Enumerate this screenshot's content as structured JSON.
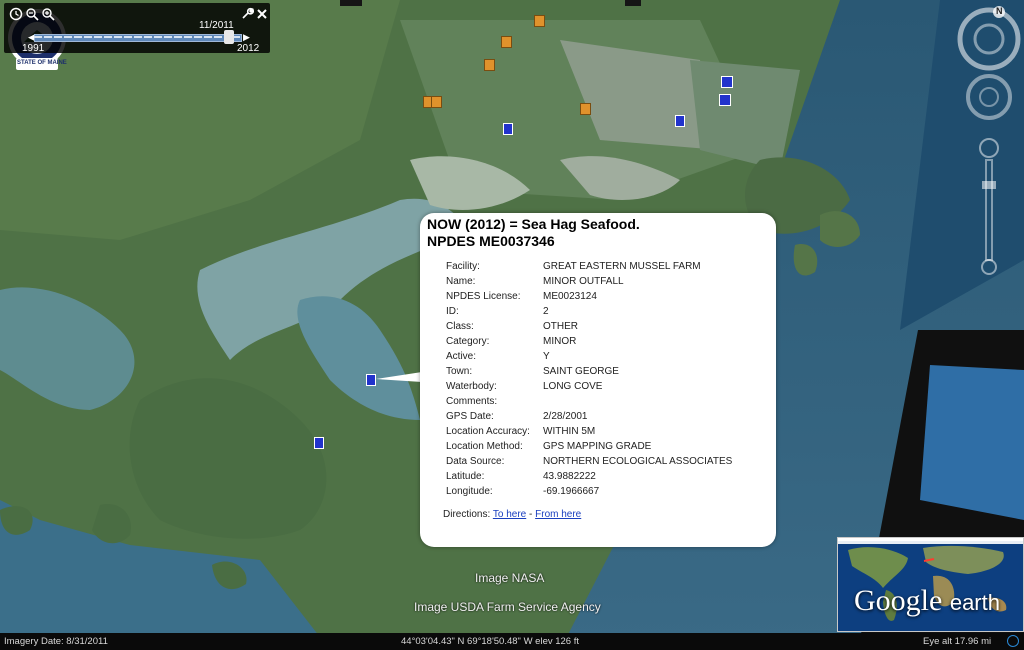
{
  "time_slider": {
    "current_date": "11/2011",
    "start_year": "1991",
    "end_year": "2012",
    "icons": [
      "clock-icon",
      "zoom-out-icon",
      "zoom-in-icon",
      "wrench-icon",
      "close-icon"
    ]
  },
  "seal_text": "STATE OF MAINE",
  "popup": {
    "title_line1": "NOW (2012) = Sea Hag Seafood.",
    "title_line2": "NPDES ME0037346",
    "fields": [
      {
        "label": "Facility:",
        "value": "GREAT EASTERN MUSSEL FARM"
      },
      {
        "label": "Name:",
        "value": "MINOR OUTFALL"
      },
      {
        "label": "NPDES License:",
        "value": "ME0023124"
      },
      {
        "label": "ID:",
        "value": "2"
      },
      {
        "label": "Class:",
        "value": "OTHER"
      },
      {
        "label": "Category:",
        "value": "MINOR"
      },
      {
        "label": "Active:",
        "value": "Y"
      },
      {
        "label": "Town:",
        "value": "SAINT GEORGE"
      },
      {
        "label": "Waterbody:",
        "value": "LONG COVE"
      },
      {
        "label": "Comments:",
        "value": ""
      },
      {
        "label": "GPS Date:",
        "value": "2/28/2001"
      },
      {
        "label": "Location Accuracy:",
        "value": "WITHIN 5M"
      },
      {
        "label": "Location Method:",
        "value": "GPS MAPPING GRADE"
      },
      {
        "label": "Data Source:",
        "value": "NORTHERN ECOLOGICAL ASSOCIATES"
      },
      {
        "label": "Latitude:",
        "value": "43.9882222"
      },
      {
        "label": "Longitude:",
        "value": "-69.1966667"
      }
    ],
    "directions_label": "Directions:",
    "to_here": "To here",
    "from_here": "From here",
    "separator": "-"
  },
  "attribution": {
    "line1": "Image NASA",
    "line2": "Image USDA Farm Service Agency"
  },
  "status": {
    "imagery_date": "Imagery Date: 8/31/2011",
    "coords": "44°03'04.43\" N   69°18'50.48\" W  elev   126 ft",
    "eye_alt": "Eye alt    17.96 mi"
  },
  "logo": {
    "google": "Google",
    "earth": "earth"
  },
  "nav": {
    "north": "N"
  },
  "colors": {
    "water": "#3d7690",
    "land": "#4c6e45",
    "popup_bg": "#ffffff",
    "link": "#1a3fbf",
    "marker_blue": "#2233cc",
    "marker_orange": "#e0922c"
  }
}
